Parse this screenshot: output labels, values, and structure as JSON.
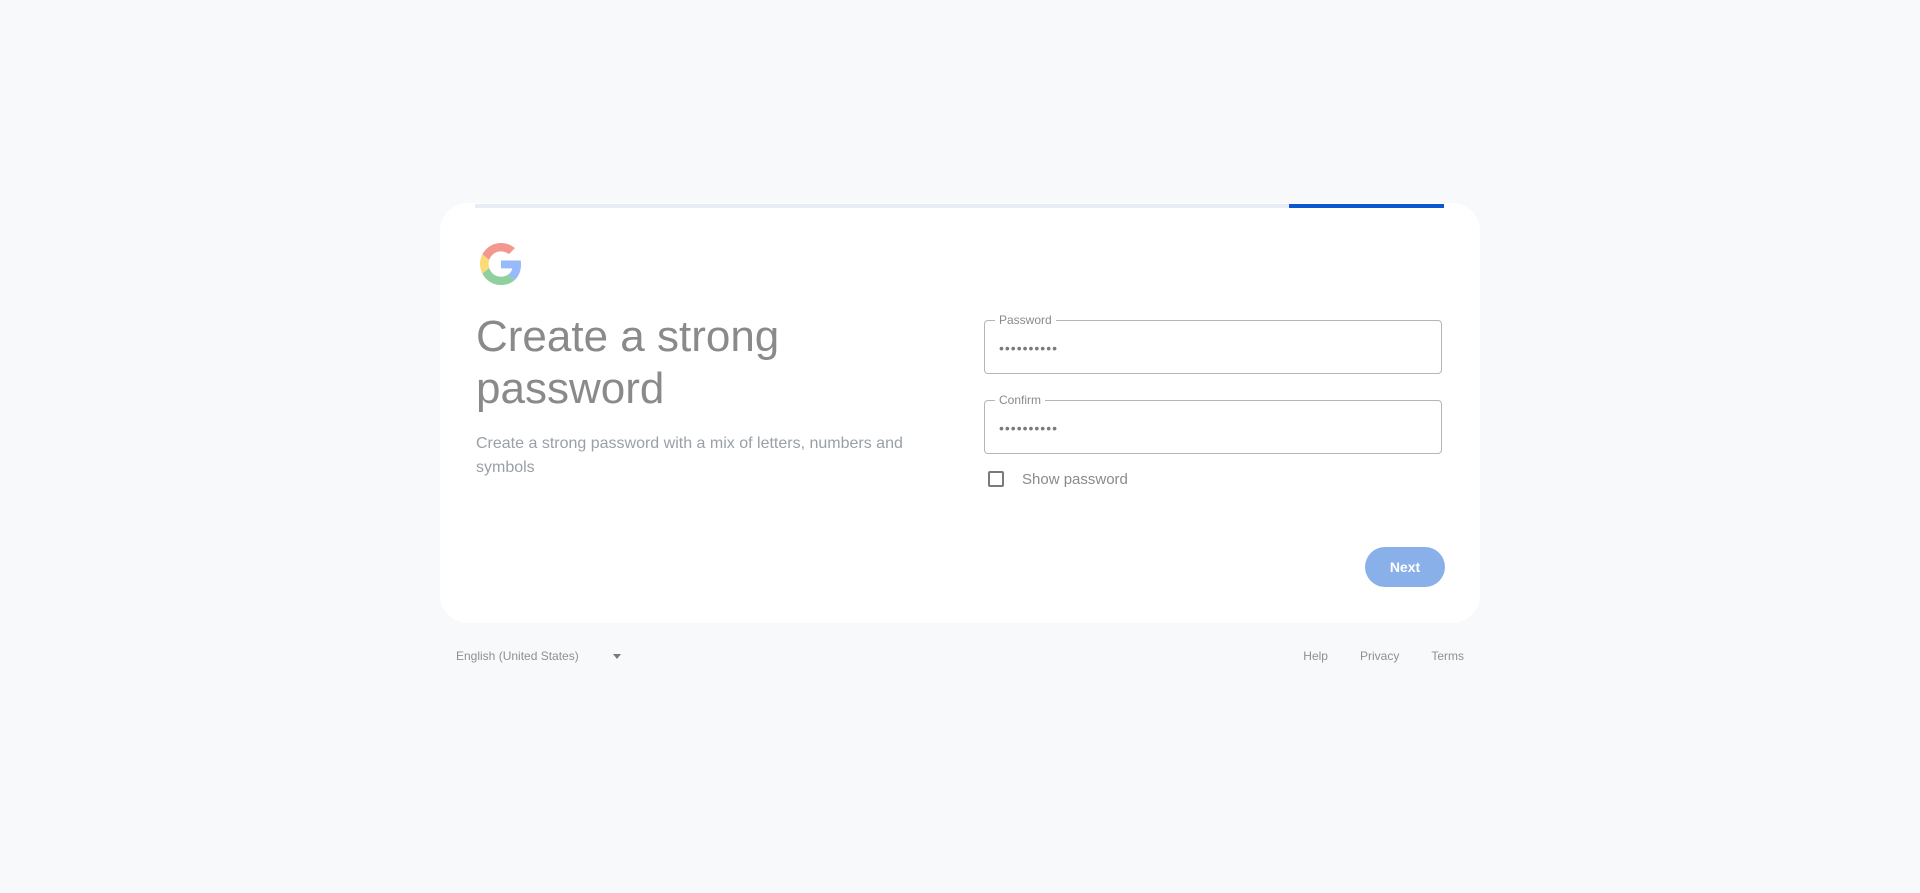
{
  "progress": {
    "value": 0.16,
    "start": 0.84,
    "color": "#0b57d0"
  },
  "logo": {
    "icon": "google-g-icon",
    "colors": [
      "#ea4335",
      "#fbbc05",
      "#34a853",
      "#4285f4"
    ]
  },
  "heading": "Create a strong password",
  "subtext": "Create a strong password with a mix of letters, numbers and symbols",
  "fields": {
    "password": {
      "label": "Password",
      "value": "••••••••••"
    },
    "confirm": {
      "label": "Confirm",
      "value": "••••••••••"
    }
  },
  "show_password": {
    "label": "Show password",
    "checked": false
  },
  "next_button": {
    "label": "Next",
    "color": "#8ab0ea"
  },
  "footer": {
    "language": "English (United States)",
    "links": [
      "Help",
      "Privacy",
      "Terms"
    ]
  }
}
